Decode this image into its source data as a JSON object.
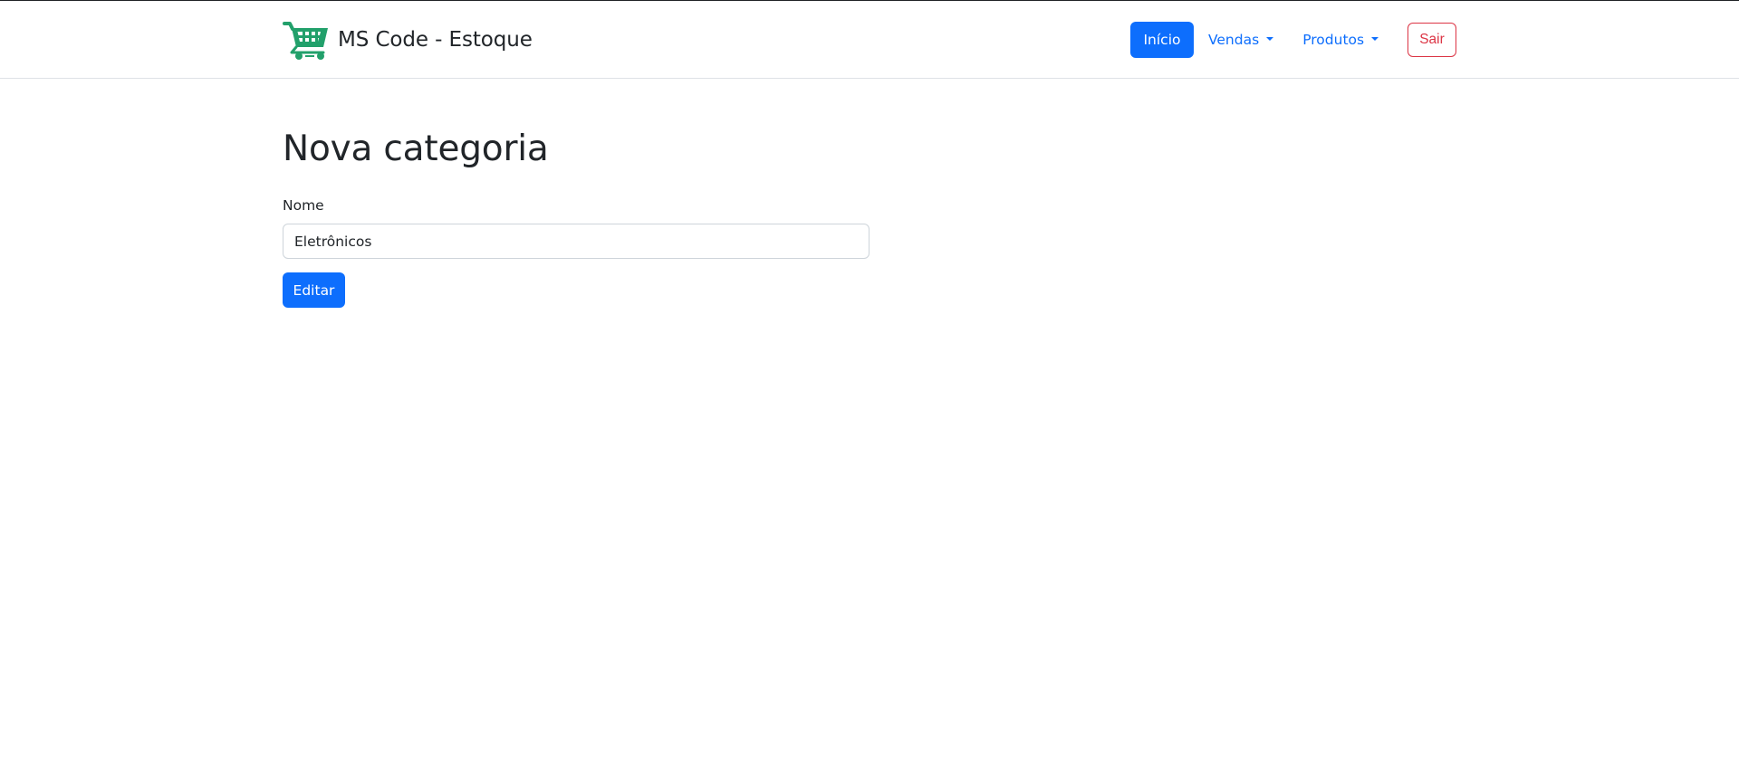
{
  "navbar": {
    "brand": {
      "text": "MS Code - Estoque",
      "icon": "shopping-cart-icon",
      "icon_color": "#22a06b"
    },
    "items": {
      "home": "Início",
      "sales": "Vendas",
      "products": "Produtos"
    },
    "logout": "Sair"
  },
  "main": {
    "title": "Nova categoria",
    "form": {
      "name_label": "Nome",
      "name_value": "Eletrônicos",
      "submit_label": "Editar"
    }
  },
  "colors": {
    "primary": "#0d6efd",
    "danger": "#dc3545",
    "text": "#212529",
    "border": "#dee2e6",
    "logo": "#22a06b"
  }
}
